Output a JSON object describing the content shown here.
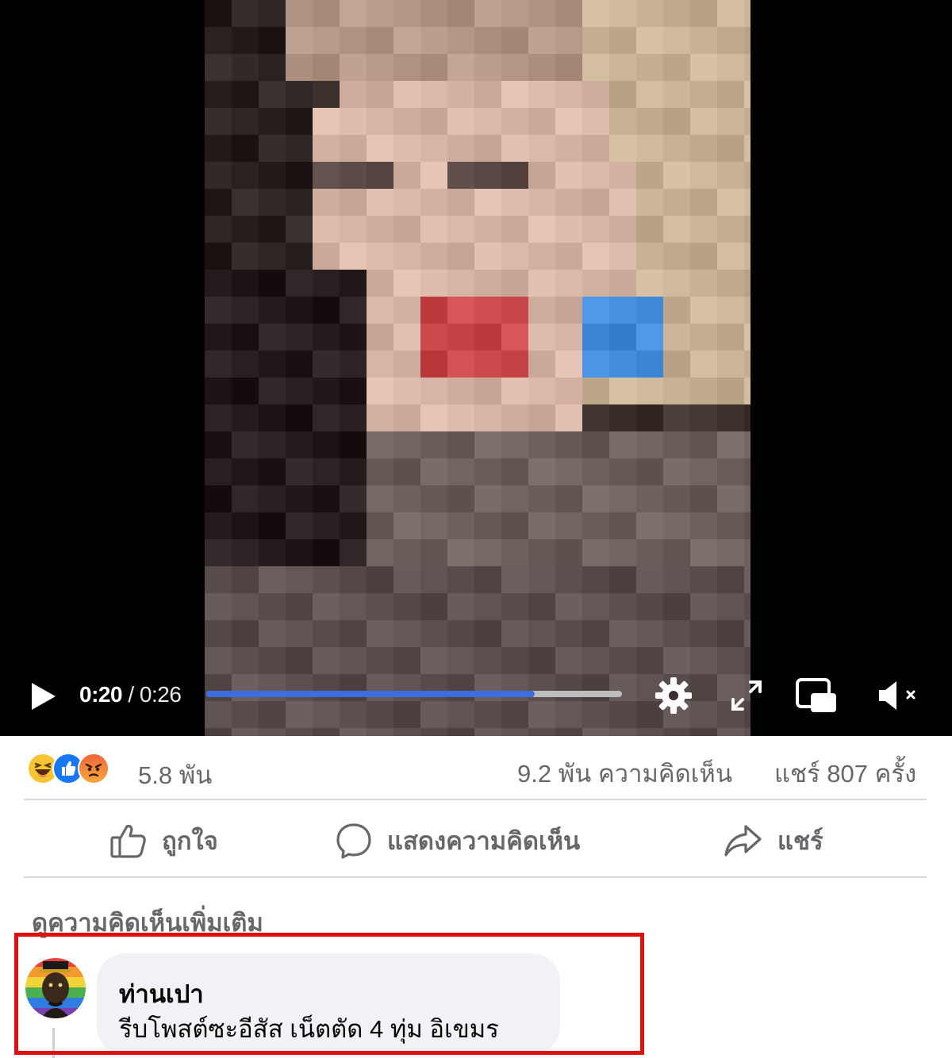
{
  "video": {
    "current_time": "0:20",
    "separator": " / ",
    "duration": "0:26",
    "progress_fraction": 0.79,
    "controls": [
      "play-icon",
      "gear-icon",
      "fullscreen-icon",
      "picture-in-picture-icon",
      "mute-icon"
    ]
  },
  "stats": {
    "reactions": [
      "haha",
      "like",
      "angry"
    ],
    "reaction_count": "5.8 พัน",
    "comment_count": "9.2 พัน ความคิดเห็น",
    "share_count": "แชร์ 807 ครั้ง"
  },
  "actions": {
    "like_label": "ถูกใจ",
    "comment_label": "แสดงความคิดเห็น",
    "share_label": "แชร์"
  },
  "comments": {
    "view_more": "ดูความคิดเห็นเพิ่มเติม",
    "items": [
      {
        "author": "ท่านเปา",
        "text": "รีบโพสต์ซะอีสัส เน็ตตัด 4 ทุ่ม อิเขมร"
      }
    ]
  },
  "colors": {
    "accent": "#1877f2",
    "progress": "#3b6fe0",
    "highlight_border": "#e01010",
    "muted_text": "#65676b",
    "bubble_bg": "#f0f2f5"
  }
}
